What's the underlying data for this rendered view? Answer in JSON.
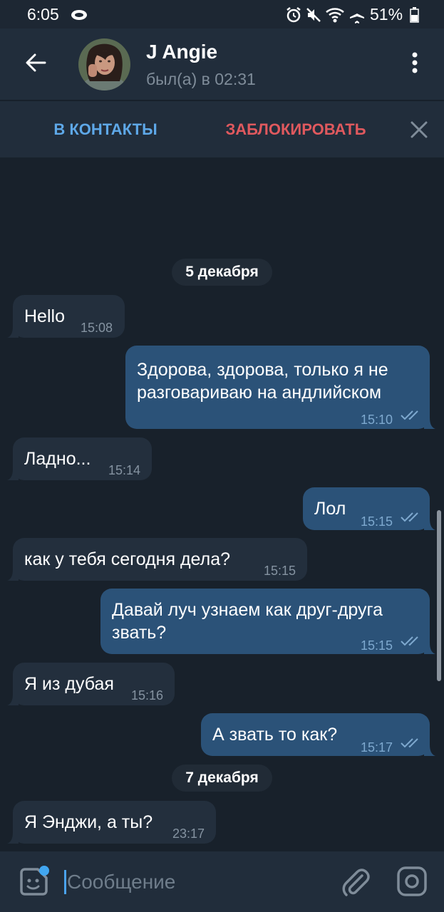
{
  "status_bar": {
    "time": "6:05",
    "battery": "51%",
    "icons": [
      "cloud-icon",
      "alarm-icon",
      "mute-icon",
      "wifi-icon",
      "airplane-icon",
      "battery-icon"
    ]
  },
  "header": {
    "title": "J Angie",
    "subtitle": "был(а) в 02:31",
    "icons": [
      "back-arrow-icon",
      "more-vertical-icon"
    ]
  },
  "action_bar": {
    "add_contact": "В КОНТАКТЫ",
    "block": "ЗАБЛОКИРОВАТЬ",
    "icons": [
      "close-icon"
    ]
  },
  "chat": {
    "date_1": "5 декабря",
    "date_2": "7 декабря",
    "messages": [
      {
        "dir": "in",
        "text": "Hello",
        "time": "15:08"
      },
      {
        "dir": "out",
        "text_line1": "Здорова, здорова, только я не",
        "text_line2": "разговариваю на андлийском",
        "time": "15:10",
        "status": "read"
      },
      {
        "dir": "in",
        "text": "Ладно...",
        "time": "15:14"
      },
      {
        "dir": "out",
        "text": "Лол",
        "time": "15:15",
        "status": "read"
      },
      {
        "dir": "in",
        "text": "как у тебя сегодня дела?",
        "time": "15:15"
      },
      {
        "dir": "out",
        "text_line1": "Давай луч узнаем как друг-друга",
        "text_line2": "звать?",
        "time": "15:15",
        "status": "read"
      },
      {
        "dir": "in",
        "text": "Я из дубая",
        "time": "15:16"
      },
      {
        "dir": "out",
        "text": "А звать то как?",
        "time": "15:17",
        "status": "read"
      },
      {
        "dir": "in",
        "text": "Я Энджи, а ты?",
        "time": "23:17"
      }
    ]
  },
  "composer": {
    "placeholder": "Сообщение",
    "icons": [
      "sticker-icon",
      "attach-icon",
      "camera-icon"
    ]
  },
  "colors": {
    "background": "#18212b",
    "header": "#212d3b",
    "incoming_bubble": "#232f3d",
    "outgoing_bubble": "#2b5278",
    "accent_blue": "#5ea8e8",
    "danger_red": "#e0595e"
  }
}
